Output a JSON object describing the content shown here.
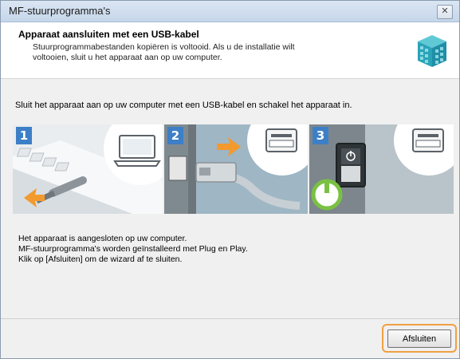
{
  "window": {
    "title": "MF-stuurprogramma's",
    "close_symbol": "✕"
  },
  "header": {
    "title": "Apparaat aansluiten met een USB-kabel",
    "description_line1": "Stuurprogrammabestanden kopiëren is voltooid. Als u de installatie wilt",
    "description_line2": "voltooien, sluit u het apparaat aan op uw computer.",
    "icon": "driver-package-icon"
  },
  "main": {
    "instruction": "Sluit het apparaat aan op uw computer met een USB-kabel en schakel het apparaat in.",
    "steps": [
      {
        "number": "1",
        "icon": "laptop-usb-icon"
      },
      {
        "number": "2",
        "icon": "printer-usb-port-icon"
      },
      {
        "number": "3",
        "icon": "power-switch-icon"
      }
    ],
    "status_lines": [
      "Het apparaat is aangesloten op uw computer.",
      "MF-stuurprogramma's worden geïnstalleerd met Plug en Play.",
      "Klik op [Afsluiten] om de wizard af te sluiten."
    ]
  },
  "footer": {
    "finish_label": "Afsluiten"
  },
  "colors": {
    "step_badge": "#3d7fc7",
    "highlight_ring": "#f0a042",
    "arrow": "#f29a2e",
    "power_green": "#7ac143"
  }
}
